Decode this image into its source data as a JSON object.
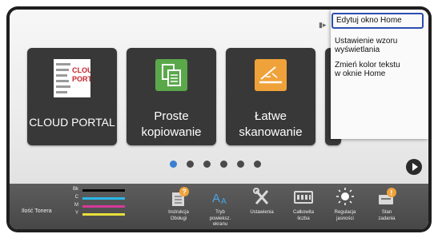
{
  "tiles": [
    {
      "label": "CLOUD PORTAL",
      "logo_text_1": "CLOUD",
      "logo_text_2": "PORTAL",
      "icon": "cloud-portal-icon"
    },
    {
      "label_1": "Proste",
      "label_2": "kopiowanie",
      "icon": "copy-icon"
    },
    {
      "label_1": "Łatwe",
      "label_2": "skanowanie",
      "icon": "scan-icon"
    }
  ],
  "page_indicator": {
    "count": 6,
    "active_index": 1
  },
  "menu": {
    "items": [
      {
        "line1": "Edytuj okno Home",
        "line2": "",
        "selected": true
      },
      {
        "line1": "Ustawienie wzoru",
        "line2": "wyświetlania",
        "selected": false
      },
      {
        "line1": "Zmień kolor tekstu",
        "line2": "w oknie Home",
        "selected": false
      }
    ]
  },
  "toner": {
    "label": "Ilość Tonera",
    "colors": [
      {
        "code": "Bk",
        "hex": "#000000"
      },
      {
        "code": "C",
        "hex": "#29b6e8"
      },
      {
        "code": "M",
        "hex": "#d6399a"
      },
      {
        "code": "Y",
        "hex": "#e8e03a"
      }
    ]
  },
  "bottom_buttons": [
    {
      "line1": "Instrukcja",
      "line2": "Obsługi",
      "line3": "",
      "icon": "manual-icon"
    },
    {
      "line1": "Tryb",
      "line2": "powieksz.",
      "line3": "ekranu",
      "icon": "enlarge-icon"
    },
    {
      "line1": "Ustawienia",
      "line2": "",
      "line3": "",
      "icon": "settings-icon"
    },
    {
      "line1": "Całkowita",
      "line2": "liczba",
      "line3": "",
      "icon": "counter-icon"
    },
    {
      "line1": "Regulacja",
      "line2": "jasności",
      "line3": "",
      "icon": "brightness-icon"
    },
    {
      "line1": "Stan",
      "line2": "zadania",
      "line3": "",
      "icon": "job-status-icon"
    }
  ],
  "colors": {
    "accent": "#3a7fd0",
    "selection_border": "#2a4fb0",
    "scan_orange": "#f0a23a",
    "copy_green": "#5aa84a",
    "cloud_red": "#c8232c"
  }
}
